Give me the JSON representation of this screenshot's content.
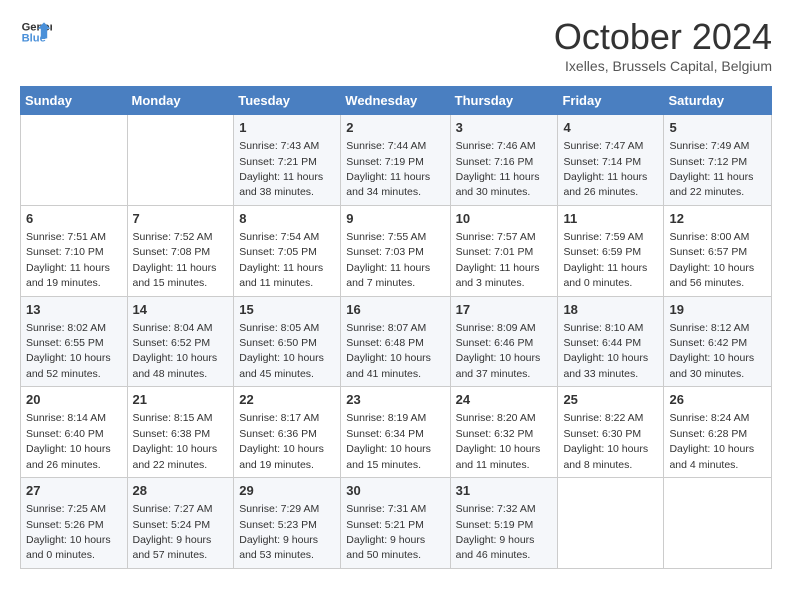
{
  "header": {
    "logo_line1": "General",
    "logo_line2": "Blue",
    "month_title": "October 2024",
    "subtitle": "Ixelles, Brussels Capital, Belgium"
  },
  "weekdays": [
    "Sunday",
    "Monday",
    "Tuesday",
    "Wednesday",
    "Thursday",
    "Friday",
    "Saturday"
  ],
  "weeks": [
    [
      {
        "day": "",
        "sunrise": "",
        "sunset": "",
        "daylight": ""
      },
      {
        "day": "",
        "sunrise": "",
        "sunset": "",
        "daylight": ""
      },
      {
        "day": "1",
        "sunrise": "Sunrise: 7:43 AM",
        "sunset": "Sunset: 7:21 PM",
        "daylight": "Daylight: 11 hours and 38 minutes."
      },
      {
        "day": "2",
        "sunrise": "Sunrise: 7:44 AM",
        "sunset": "Sunset: 7:19 PM",
        "daylight": "Daylight: 11 hours and 34 minutes."
      },
      {
        "day": "3",
        "sunrise": "Sunrise: 7:46 AM",
        "sunset": "Sunset: 7:16 PM",
        "daylight": "Daylight: 11 hours and 30 minutes."
      },
      {
        "day": "4",
        "sunrise": "Sunrise: 7:47 AM",
        "sunset": "Sunset: 7:14 PM",
        "daylight": "Daylight: 11 hours and 26 minutes."
      },
      {
        "day": "5",
        "sunrise": "Sunrise: 7:49 AM",
        "sunset": "Sunset: 7:12 PM",
        "daylight": "Daylight: 11 hours and 22 minutes."
      }
    ],
    [
      {
        "day": "6",
        "sunrise": "Sunrise: 7:51 AM",
        "sunset": "Sunset: 7:10 PM",
        "daylight": "Daylight: 11 hours and 19 minutes."
      },
      {
        "day": "7",
        "sunrise": "Sunrise: 7:52 AM",
        "sunset": "Sunset: 7:08 PM",
        "daylight": "Daylight: 11 hours and 15 minutes."
      },
      {
        "day": "8",
        "sunrise": "Sunrise: 7:54 AM",
        "sunset": "Sunset: 7:05 PM",
        "daylight": "Daylight: 11 hours and 11 minutes."
      },
      {
        "day": "9",
        "sunrise": "Sunrise: 7:55 AM",
        "sunset": "Sunset: 7:03 PM",
        "daylight": "Daylight: 11 hours and 7 minutes."
      },
      {
        "day": "10",
        "sunrise": "Sunrise: 7:57 AM",
        "sunset": "Sunset: 7:01 PM",
        "daylight": "Daylight: 11 hours and 3 minutes."
      },
      {
        "day": "11",
        "sunrise": "Sunrise: 7:59 AM",
        "sunset": "Sunset: 6:59 PM",
        "daylight": "Daylight: 11 hours and 0 minutes."
      },
      {
        "day": "12",
        "sunrise": "Sunrise: 8:00 AM",
        "sunset": "Sunset: 6:57 PM",
        "daylight": "Daylight: 10 hours and 56 minutes."
      }
    ],
    [
      {
        "day": "13",
        "sunrise": "Sunrise: 8:02 AM",
        "sunset": "Sunset: 6:55 PM",
        "daylight": "Daylight: 10 hours and 52 minutes."
      },
      {
        "day": "14",
        "sunrise": "Sunrise: 8:04 AM",
        "sunset": "Sunset: 6:52 PM",
        "daylight": "Daylight: 10 hours and 48 minutes."
      },
      {
        "day": "15",
        "sunrise": "Sunrise: 8:05 AM",
        "sunset": "Sunset: 6:50 PM",
        "daylight": "Daylight: 10 hours and 45 minutes."
      },
      {
        "day": "16",
        "sunrise": "Sunrise: 8:07 AM",
        "sunset": "Sunset: 6:48 PM",
        "daylight": "Daylight: 10 hours and 41 minutes."
      },
      {
        "day": "17",
        "sunrise": "Sunrise: 8:09 AM",
        "sunset": "Sunset: 6:46 PM",
        "daylight": "Daylight: 10 hours and 37 minutes."
      },
      {
        "day": "18",
        "sunrise": "Sunrise: 8:10 AM",
        "sunset": "Sunset: 6:44 PM",
        "daylight": "Daylight: 10 hours and 33 minutes."
      },
      {
        "day": "19",
        "sunrise": "Sunrise: 8:12 AM",
        "sunset": "Sunset: 6:42 PM",
        "daylight": "Daylight: 10 hours and 30 minutes."
      }
    ],
    [
      {
        "day": "20",
        "sunrise": "Sunrise: 8:14 AM",
        "sunset": "Sunset: 6:40 PM",
        "daylight": "Daylight: 10 hours and 26 minutes."
      },
      {
        "day": "21",
        "sunrise": "Sunrise: 8:15 AM",
        "sunset": "Sunset: 6:38 PM",
        "daylight": "Daylight: 10 hours and 22 minutes."
      },
      {
        "day": "22",
        "sunrise": "Sunrise: 8:17 AM",
        "sunset": "Sunset: 6:36 PM",
        "daylight": "Daylight: 10 hours and 19 minutes."
      },
      {
        "day": "23",
        "sunrise": "Sunrise: 8:19 AM",
        "sunset": "Sunset: 6:34 PM",
        "daylight": "Daylight: 10 hours and 15 minutes."
      },
      {
        "day": "24",
        "sunrise": "Sunrise: 8:20 AM",
        "sunset": "Sunset: 6:32 PM",
        "daylight": "Daylight: 10 hours and 11 minutes."
      },
      {
        "day": "25",
        "sunrise": "Sunrise: 8:22 AM",
        "sunset": "Sunset: 6:30 PM",
        "daylight": "Daylight: 10 hours and 8 minutes."
      },
      {
        "day": "26",
        "sunrise": "Sunrise: 8:24 AM",
        "sunset": "Sunset: 6:28 PM",
        "daylight": "Daylight: 10 hours and 4 minutes."
      }
    ],
    [
      {
        "day": "27",
        "sunrise": "Sunrise: 7:25 AM",
        "sunset": "Sunset: 5:26 PM",
        "daylight": "Daylight: 10 hours and 0 minutes."
      },
      {
        "day": "28",
        "sunrise": "Sunrise: 7:27 AM",
        "sunset": "Sunset: 5:24 PM",
        "daylight": "Daylight: 9 hours and 57 minutes."
      },
      {
        "day": "29",
        "sunrise": "Sunrise: 7:29 AM",
        "sunset": "Sunset: 5:23 PM",
        "daylight": "Daylight: 9 hours and 53 minutes."
      },
      {
        "day": "30",
        "sunrise": "Sunrise: 7:31 AM",
        "sunset": "Sunset: 5:21 PM",
        "daylight": "Daylight: 9 hours and 50 minutes."
      },
      {
        "day": "31",
        "sunrise": "Sunrise: 7:32 AM",
        "sunset": "Sunset: 5:19 PM",
        "daylight": "Daylight: 9 hours and 46 minutes."
      },
      {
        "day": "",
        "sunrise": "",
        "sunset": "",
        "daylight": ""
      },
      {
        "day": "",
        "sunrise": "",
        "sunset": "",
        "daylight": ""
      }
    ]
  ]
}
